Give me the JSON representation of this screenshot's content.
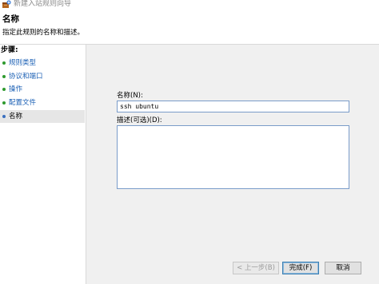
{
  "window": {
    "title": "新建入站规则向导",
    "icon": "firewall-rule-icon"
  },
  "header": {
    "title": "名称",
    "subtitle": "指定此规则的名称和描述。"
  },
  "steps": {
    "heading": "步骤:",
    "items": [
      {
        "label": "规则类型",
        "active": false
      },
      {
        "label": "协议和端口",
        "active": false
      },
      {
        "label": "操作",
        "active": false
      },
      {
        "label": "配置文件",
        "active": false
      },
      {
        "label": "名称",
        "active": true
      }
    ]
  },
  "form": {
    "name_label": "名称(N):",
    "name_value": "ssh ubuntu",
    "description_label": "描述(可选)(D):",
    "description_value": ""
  },
  "buttons": {
    "back": "< 上一步(B)",
    "finish": "完成(F)",
    "cancel": "取消"
  },
  "colors": {
    "step_link": "#1a5fb4",
    "step_bullet": "#2e9a2e",
    "active_step_bg": "#e6e6e6",
    "panel_bg": "#f0f0f0"
  }
}
